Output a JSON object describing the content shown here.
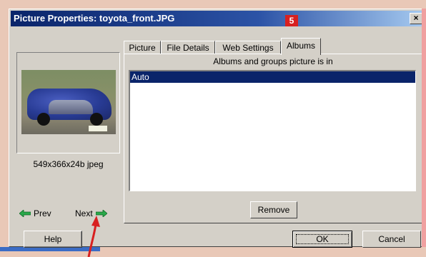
{
  "window": {
    "title": "Picture Properties: toyota_front.JPG",
    "close_glyph": "×"
  },
  "tabs": [
    {
      "label": "Picture",
      "active": false
    },
    {
      "label": "File Details",
      "active": false
    },
    {
      "label": "Web Settings",
      "active": false
    },
    {
      "label": "Albums",
      "active": true
    }
  ],
  "badge": "5",
  "albums_panel": {
    "caption": "Albums and groups picture is in",
    "items": [
      "Auto"
    ],
    "selected_index": 0,
    "remove_label": "Remove"
  },
  "preview": {
    "dimensions": "549x366x24b jpeg",
    "prev_label": "Prev",
    "next_label": "Next"
  },
  "buttons": {
    "help": "Help",
    "ok": "OK",
    "cancel": "Cancel"
  },
  "colors": {
    "accent": "#0a246a",
    "badge": "#d82020",
    "arrow_green": "#2aa84a",
    "annotation_red": "#d82020"
  },
  "icons": [
    "close-icon",
    "prev-arrow-icon",
    "next-arrow-icon",
    "annotation-arrow-icon"
  ]
}
